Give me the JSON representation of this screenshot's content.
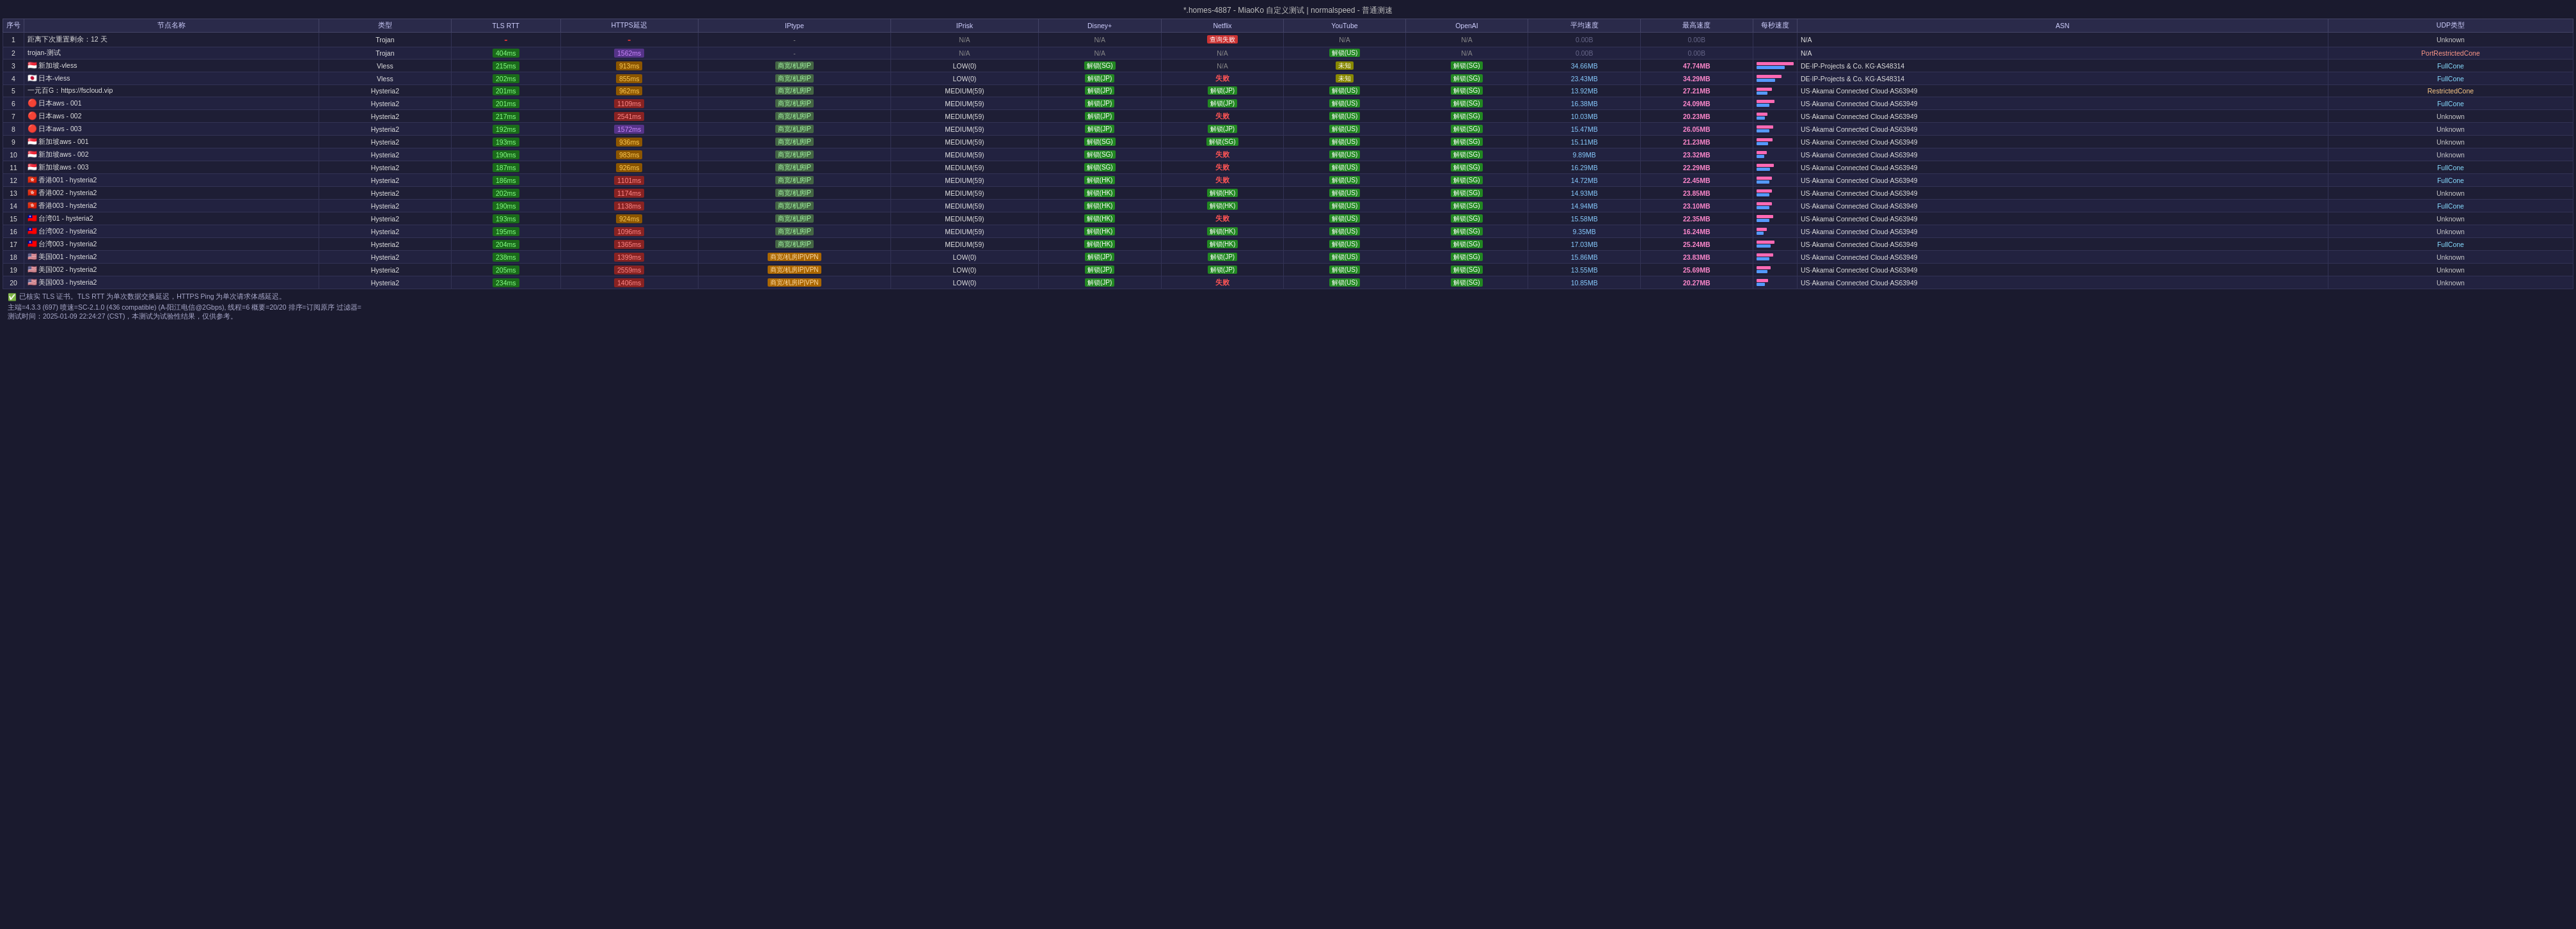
{
  "title": "*.homes-4887 - MiaoKo 自定义测试 | normalspeed - 普通测速",
  "columns": [
    "序号",
    "节点名称",
    "类型",
    "TLS RTT",
    "HTTPS延迟",
    "IPtype",
    "IPrisk",
    "Disney+",
    "Netflix",
    "YouTube",
    "OpenAI",
    "平均速度",
    "最高速度",
    "每秒速度",
    "ASN",
    "UDP类型"
  ],
  "rows": [
    {
      "seq": "1",
      "name": "距离下次重置剩余：12 天",
      "type": "Trojan",
      "flag": "",
      "tls": "-",
      "tls_class": "tls-dash",
      "https": "-",
      "https_class": "tls-dash",
      "iptype": "-",
      "iprisk": "N/A",
      "disney": "N/A",
      "disney_class": "badge-na",
      "netflix": "查询失败",
      "netflix_class": "badge-query-fail",
      "youtube": "N/A",
      "youtube_class": "badge-na",
      "openai": "N/A",
      "openai_class": "badge-na",
      "openai2": "N/A",
      "avg": "0.00B",
      "max": "0.00B",
      "asn": "N/A",
      "udp": "Unknown"
    },
    {
      "seq": "2",
      "name": "trojan-测试",
      "type": "Trojan",
      "flag": "",
      "tls": "404ms",
      "tls_class": "tls-green",
      "https": "1562ms",
      "https_class": "https-purple",
      "iptype": "-",
      "iprisk": "N/A",
      "disney": "N/A",
      "disney_class": "badge-na",
      "netflix": "N/A",
      "netflix_class": "badge-na",
      "youtube": "解锁(US)",
      "youtube_class": "badge-unlock-us",
      "openai": "N/A",
      "openai_class": "badge-na",
      "openai2": "",
      "avg": "0.00B",
      "max": "0.00B",
      "asn": "N/A",
      "udp": "PortRestrictedCone"
    },
    {
      "seq": "3",
      "name": "新加坡-vless",
      "type": "Vless",
      "flag": "🇸🇬",
      "tls": "215ms",
      "tls_class": "tls-green",
      "https": "913ms",
      "https_class": "https-orange",
      "iptype": "商宽/机房IP",
      "iptype_class": "iptype-residential",
      "iprisk": "LOW(0)",
      "disney": "解锁(SG)",
      "disney_class": "badge-unlock-sg",
      "netflix": "N/A",
      "netflix_class": "badge-na",
      "youtube": "未知",
      "youtube_class": "badge-unknown-yellow",
      "openai": "解锁(SG)",
      "openai_class": "badge-unlock-sg",
      "avg": "34.66MB",
      "max": "47.74MB",
      "bar1": 73,
      "bar2": 55,
      "asn": "DE·IP-Projects & Co. KG·AS48314",
      "udp": "FullCone"
    },
    {
      "seq": "4",
      "name": "日本-vless",
      "type": "Vless",
      "flag": "🇯🇵",
      "tls": "202ms",
      "tls_class": "tls-green",
      "https": "855ms",
      "https_class": "https-orange",
      "iptype": "商宽/机房IP",
      "iptype_class": "iptype-residential",
      "iprisk": "LOW(0)",
      "disney": "解锁(JP)",
      "disney_class": "badge-unlock-jp",
      "netflix": "失败",
      "netflix_class": "badge-fail",
      "youtube": "未知",
      "youtube_class": "badge-unknown-yellow",
      "openai": "解锁(SG)",
      "openai_class": "badge-unlock-sg",
      "avg": "23.43MB",
      "max": "34.29MB",
      "bar1": 49,
      "bar2": 37,
      "asn": "DE·IP-Projects & Co. KG·AS48314",
      "udp": "FullCone"
    },
    {
      "seq": "5",
      "name": "一元百G：https://fscloud.vip",
      "type": "Hysteria2",
      "flag": "",
      "tls": "201ms",
      "tls_class": "tls-green",
      "https": "962ms",
      "https_class": "https-orange",
      "iptype": "商宽/机房IP",
      "iptype_class": "iptype-residential",
      "iprisk": "MEDIUM(59)",
      "disney": "解锁(JP)",
      "disney_class": "badge-unlock-jp",
      "netflix": "解锁(JP)",
      "netflix_class": "badge-unlock-jp",
      "youtube": "解锁(US)",
      "youtube_class": "badge-unlock-us",
      "openai": "解锁(SG)",
      "openai_class": "badge-unlock-sg",
      "avg": "13.92MB",
      "max": "27.21MB",
      "bar1": 30,
      "bar2": 22,
      "asn": "US·Akamai Connected Cloud·AS63949",
      "udp": "RestrictedCone"
    },
    {
      "seq": "6",
      "name": "日本aws - 001",
      "type": "Hysteria2",
      "flag": "🔴",
      "tls": "201ms",
      "tls_class": "tls-green",
      "https": "1109ms",
      "https_class": "https-red",
      "iptype": "商宽/机房IP",
      "iptype_class": "iptype-residential",
      "iprisk": "MEDIUM(59)",
      "disney": "解锁(JP)",
      "disney_class": "badge-unlock-jp",
      "netflix": "解锁(JP)",
      "netflix_class": "badge-unlock-jp",
      "youtube": "解锁(US)",
      "youtube_class": "badge-unlock-us",
      "openai": "解锁(SG)",
      "openai_class": "badge-unlock-sg",
      "avg": "16.38MB",
      "max": "24.09MB",
      "bar1": 35,
      "bar2": 26,
      "asn": "US·Akamai Connected Cloud·AS63949",
      "udp": "FullCone"
    },
    {
      "seq": "7",
      "name": "日本aws - 002",
      "type": "Hysteria2",
      "flag": "🔴",
      "tls": "217ms",
      "tls_class": "tls-green",
      "https": "2541ms",
      "https_class": "https-red",
      "iptype": "商宽/机房IP",
      "iptype_class": "iptype-residential",
      "iprisk": "MEDIUM(59)",
      "disney": "解锁(JP)",
      "disney_class": "badge-unlock-jp",
      "netflix": "失败",
      "netflix_class": "badge-fail",
      "youtube": "解锁(US)",
      "youtube_class": "badge-unlock-us",
      "openai": "解锁(SG)",
      "openai_class": "badge-unlock-sg",
      "avg": "10.03MB",
      "max": "20.23MB",
      "bar1": 22,
      "bar2": 17,
      "asn": "US·Akamai Connected Cloud·AS63949",
      "udp": "Unknown"
    },
    {
      "seq": "8",
      "name": "日本aws - 003",
      "type": "Hysteria2",
      "flag": "🔴",
      "tls": "192ms",
      "tls_class": "tls-green",
      "https": "1572ms",
      "https_class": "https-purple",
      "iptype": "商宽/机房IP",
      "iptype_class": "iptype-residential",
      "iprisk": "MEDIUM(59)",
      "disney": "解锁(JP)",
      "disney_class": "badge-unlock-jp",
      "netflix": "解锁(JP)",
      "netflix_class": "badge-unlock-jp",
      "youtube": "解锁(US)",
      "youtube_class": "badge-unlock-us",
      "openai": "解锁(SG)",
      "openai_class": "badge-unlock-sg",
      "avg": "15.47MB",
      "max": "26.05MB",
      "bar1": 33,
      "bar2": 26,
      "asn": "US·Akamai Connected Cloud·AS63949",
      "udp": "Unknown"
    },
    {
      "seq": "9",
      "name": "新加坡aws - 001",
      "type": "Hysteria2",
      "flag": "🇸🇬",
      "tls": "193ms",
      "tls_class": "tls-green",
      "https": "936ms",
      "https_class": "https-orange",
      "iptype": "商宽/机房IP",
      "iptype_class": "iptype-residential",
      "iprisk": "MEDIUM(59)",
      "disney": "解锁(SG)",
      "disney_class": "badge-unlock-sg",
      "netflix": "解锁(SG)",
      "netflix_class": "badge-unlock-sg",
      "youtube": "解锁(US)",
      "youtube_class": "badge-unlock-us",
      "openai": "解锁(SG)",
      "openai_class": "badge-unlock-sg",
      "avg": "15.11MB",
      "max": "21.23MB",
      "bar1": 32,
      "bar2": 23,
      "asn": "US·Akamai Connected Cloud·AS63949",
      "udp": "Unknown"
    },
    {
      "seq": "10",
      "name": "新加坡aws - 002",
      "type": "Hysteria2",
      "flag": "🇸🇬",
      "tls": "190ms",
      "tls_class": "tls-green",
      "https": "983ms",
      "https_class": "https-orange",
      "iptype": "商宽/机房IP",
      "iptype_class": "iptype-residential",
      "iprisk": "MEDIUM(59)",
      "disney": "解锁(SG)",
      "disney_class": "badge-unlock-sg",
      "netflix": "失败",
      "netflix_class": "badge-fail",
      "youtube": "解锁(US)",
      "youtube_class": "badge-unlock-us",
      "openai": "解锁(SG)",
      "openai_class": "badge-unlock-sg",
      "avg": "9.89MB",
      "max": "23.32MB",
      "bar1": 21,
      "bar2": 16,
      "asn": "US·Akamai Connected Cloud·AS63949",
      "udp": "Unknown"
    },
    {
      "seq": "11",
      "name": "新加坡aws - 003",
      "type": "Hysteria2",
      "flag": "🇸🇬",
      "tls": "187ms",
      "tls_class": "tls-green",
      "https": "926ms",
      "https_class": "https-orange",
      "iptype": "商宽/机房IP",
      "iptype_class": "iptype-residential",
      "iprisk": "MEDIUM(59)",
      "disney": "解锁(SG)",
      "disney_class": "badge-unlock-sg",
      "netflix": "失败",
      "netflix_class": "badge-fail",
      "youtube": "解锁(US)",
      "youtube_class": "badge-unlock-us",
      "openai": "解锁(SG)",
      "openai_class": "badge-unlock-sg",
      "avg": "16.29MB",
      "max": "22.29MB",
      "bar1": 34,
      "bar2": 27,
      "asn": "US·Akamai Connected Cloud·AS63949",
      "udp": "FullCone"
    },
    {
      "seq": "12",
      "name": "香港001 - hysteria2",
      "type": "Hysteria2",
      "flag": "🇭🇰",
      "tls": "186ms",
      "tls_class": "tls-green",
      "https": "1101ms",
      "https_class": "https-red",
      "iptype": "商宽/机房IP",
      "iptype_class": "iptype-residential",
      "iprisk": "MEDIUM(59)",
      "disney": "解锁(HK)",
      "disney_class": "badge-unlock-hk",
      "netflix": "失败",
      "netflix_class": "badge-fail",
      "youtube": "解锁(US)",
      "youtube_class": "badge-unlock-us",
      "openai": "解锁(SG)",
      "openai_class": "badge-unlock-sg",
      "avg": "14.72MB",
      "max": "22.45MB",
      "bar1": 31,
      "bar2": 25,
      "asn": "US·Akamai Connected Cloud·AS63949",
      "udp": "FullCone"
    },
    {
      "seq": "13",
      "name": "香港002 - hysteria2",
      "type": "Hysteria2",
      "flag": "🇭🇰",
      "tls": "202ms",
      "tls_class": "tls-green",
      "https": "1174ms",
      "https_class": "https-red",
      "iptype": "商宽/机房IP",
      "iptype_class": "iptype-residential",
      "iprisk": "MEDIUM(59)",
      "disney": "解锁(HK)",
      "disney_class": "badge-unlock-hk",
      "netflix": "解锁(HK)",
      "netflix_class": "badge-unlock-hk",
      "youtube": "解锁(US)",
      "youtube_class": "badge-unlock-us",
      "openai": "解锁(SG)",
      "openai_class": "badge-unlock-sg",
      "avg": "14.93MB",
      "max": "23.85MB",
      "bar1": 31,
      "bar2": 25,
      "asn": "US·Akamai Connected Cloud·AS63949",
      "udp": "Unknown"
    },
    {
      "seq": "14",
      "name": "香港003 - hysteria2",
      "type": "Hysteria2",
      "flag": "🇭🇰",
      "tls": "190ms",
      "tls_class": "tls-green",
      "https": "1138ms",
      "https_class": "https-red",
      "iptype": "商宽/机房IP",
      "iptype_class": "iptype-residential",
      "iprisk": "MEDIUM(59)",
      "disney": "解锁(HK)",
      "disney_class": "badge-unlock-hk",
      "netflix": "解锁(HK)",
      "netflix_class": "badge-unlock-hk",
      "youtube": "解锁(US)",
      "youtube_class": "badge-unlock-us",
      "openai": "解锁(SG)",
      "openai_class": "badge-unlock-sg",
      "avg": "14.94MB",
      "max": "23.10MB",
      "bar1": 31,
      "bar2": 25,
      "asn": "US·Akamai Connected Cloud·AS63949",
      "udp": "FullCone"
    },
    {
      "seq": "15",
      "name": "台湾01 - hysteria2",
      "type": "Hysteria2",
      "flag": "🇹🇼",
      "tls": "193ms",
      "tls_class": "tls-green",
      "https": "924ms",
      "https_class": "https-orange",
      "iptype": "商宽/机房IP",
      "iptype_class": "iptype-residential",
      "iprisk": "MEDIUM(59)",
      "disney": "解锁(HK)",
      "disney_class": "badge-unlock-hk",
      "netflix": "失败",
      "netflix_class": "badge-fail",
      "youtube": "解锁(US)",
      "youtube_class": "badge-unlock-us",
      "openai": "解锁(SG)",
      "openai_class": "badge-unlock-sg",
      "avg": "15.58MB",
      "max": "22.35MB",
      "bar1": 33,
      "bar2": 26,
      "asn": "US·Akamai Connected Cloud·AS63949",
      "udp": "Unknown"
    },
    {
      "seq": "16",
      "name": "台湾002 - hysteria2",
      "type": "Hysteria2",
      "flag": "🇹🇼",
      "tls": "195ms",
      "tls_class": "tls-green",
      "https": "1096ms",
      "https_class": "https-red",
      "iptype": "商宽/机房IP",
      "iptype_class": "iptype-residential",
      "iprisk": "MEDIUM(59)",
      "disney": "解锁(HK)",
      "disney_class": "badge-unlock-hk",
      "netflix": "解锁(HK)",
      "netflix_class": "badge-unlock-hk",
      "youtube": "解锁(US)",
      "youtube_class": "badge-unlock-us",
      "openai": "解锁(SG)",
      "openai_class": "badge-unlock-sg",
      "avg": "9.35MB",
      "max": "16.24MB",
      "bar1": 20,
      "bar2": 14,
      "asn": "US·Akamai Connected Cloud·AS63949",
      "udp": "Unknown"
    },
    {
      "seq": "17",
      "name": "台湾003 - hysteria2",
      "type": "Hysteria2",
      "flag": "🇹🇼",
      "tls": "204ms",
      "tls_class": "tls-green",
      "https": "1365ms",
      "https_class": "https-red",
      "iptype": "商宽/机房IP",
      "iptype_class": "iptype-residential",
      "iprisk": "MEDIUM(59)",
      "disney": "解锁(HK)",
      "disney_class": "badge-unlock-hk",
      "netflix": "解锁(HK)",
      "netflix_class": "badge-unlock-hk",
      "youtube": "解锁(US)",
      "youtube_class": "badge-unlock-us",
      "openai": "解锁(SG)",
      "openai_class": "badge-unlock-sg",
      "avg": "17.03MB",
      "max": "25.24MB",
      "bar1": 36,
      "bar2": 28,
      "asn": "US·Akamai Connected Cloud·AS63949",
      "udp": "FullCone"
    },
    {
      "seq": "18",
      "name": "美国001 - hysteria2",
      "type": "Hysteria2",
      "flag": "🇺🇸",
      "tls": "238ms",
      "tls_class": "tls-green",
      "https": "1399ms",
      "https_class": "https-red",
      "iptype": "商宽/机房IP|VPN",
      "iptype_class": "iptype-residential-vpn",
      "iprisk": "LOW(0)",
      "disney": "解锁(JP)",
      "disney_class": "badge-unlock-jp",
      "netflix": "解锁(JP)",
      "netflix_class": "badge-unlock-jp",
      "youtube": "解锁(US)",
      "youtube_class": "badge-unlock-us",
      "openai": "解锁(SG)",
      "openai_class": "badge-unlock-sg",
      "avg": "15.86MB",
      "max": "23.83MB",
      "bar1": 33,
      "bar2": 26,
      "asn": "US·Akamai Connected Cloud·AS63949",
      "udp": "Unknown"
    },
    {
      "seq": "19",
      "name": "美国002 - hysteria2",
      "type": "Hysteria2",
      "flag": "🇺🇸",
      "tls": "205ms",
      "tls_class": "tls-green",
      "https": "2559ms",
      "https_class": "https-red",
      "iptype": "商宽/机房IP|VPN",
      "iptype_class": "iptype-residential-vpn",
      "iprisk": "LOW(0)",
      "disney": "解锁(JP)",
      "disney_class": "badge-unlock-jp",
      "netflix": "解锁(JP)",
      "netflix_class": "badge-unlock-jp",
      "youtube": "解锁(US)",
      "youtube_class": "badge-unlock-us",
      "openai": "解锁(SG)",
      "openai_class": "badge-unlock-sg",
      "avg": "13.55MB",
      "max": "25.69MB",
      "bar1": 28,
      "bar2": 22,
      "asn": "US·Akamai Connected Cloud·AS63949",
      "udp": "Unknown"
    },
    {
      "seq": "20",
      "name": "美国003 - hysteria2",
      "type": "Hysteria2",
      "flag": "🇺🇸",
      "tls": "234ms",
      "tls_class": "tls-green",
      "https": "1406ms",
      "https_class": "https-red",
      "iptype": "商宽/机房IP|VPN",
      "iptype_class": "iptype-residential-vpn",
      "iprisk": "LOW(0)",
      "disney": "解锁(JP)",
      "disney_class": "badge-unlock-jp",
      "netflix": "失败",
      "netflix_class": "badge-fail",
      "youtube": "解锁(US)",
      "youtube_class": "badge-unlock-us",
      "openai": "解锁(SG)",
      "openai_class": "badge-unlock-sg",
      "avg": "10.85MB",
      "max": "20.27MB",
      "bar1": 23,
      "bar2": 17,
      "asn": "US·Akamai Connected Cloud·AS63949",
      "udp": "Unknown"
    }
  ],
  "footer": {
    "check": "✅ 已核实 TLS 证书。TLS RTT 为单次数据交换延迟，HTTPS Ping 为单次请求体感延迟。",
    "info": "主端=4.3.3 (697) 喷速=SC-2.1.0 (436 compatible) (A-阳江电信@2Gbps), 线程=6 概要=20/20 排序=订阅原序 过滤器=",
    "time": "测试时间：2025-01-09 22:24:27 (CST)，本测试为试验性结果，仅供参考。"
  }
}
